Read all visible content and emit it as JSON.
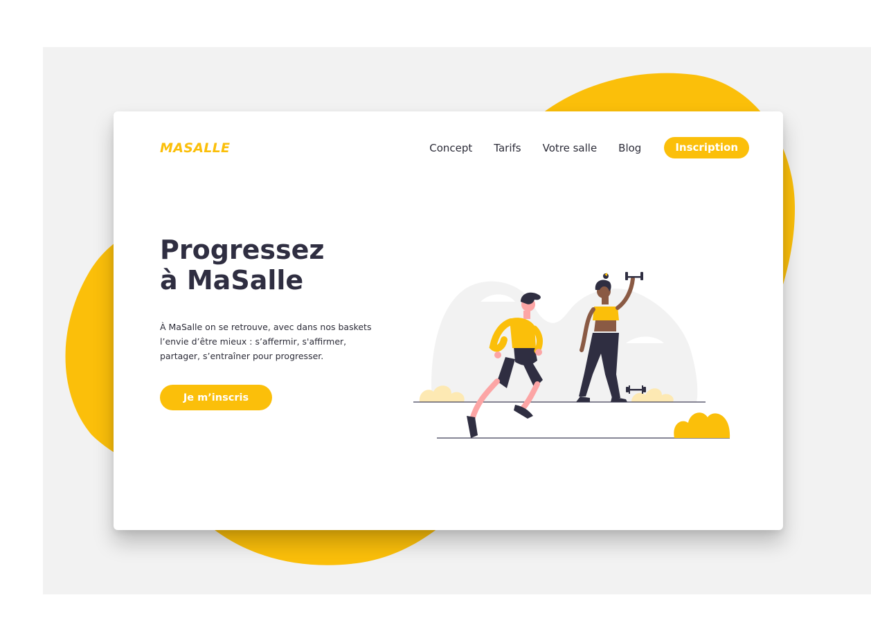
{
  "brand": {
    "name": "MASALLE"
  },
  "nav": {
    "links": [
      "Concept",
      "Tarifs",
      "Votre salle",
      "Blog"
    ],
    "cta": "Inscription"
  },
  "hero": {
    "title_line1": "Progressez",
    "title_line2": "à MaSalle",
    "description": "À MaSalle on se retrouve, avec dans nos baskets l’envie d’être mieux : s’affermir, s'affirmer, partager, s’entraîner pour progresser.",
    "cta": "Je m’inscris"
  },
  "colors": {
    "accent": "#fbbf0a",
    "dark": "#2f2e41",
    "backdrop": "#f2f2f2"
  },
  "illustration": {
    "icon": "fitness-people-illustration"
  }
}
